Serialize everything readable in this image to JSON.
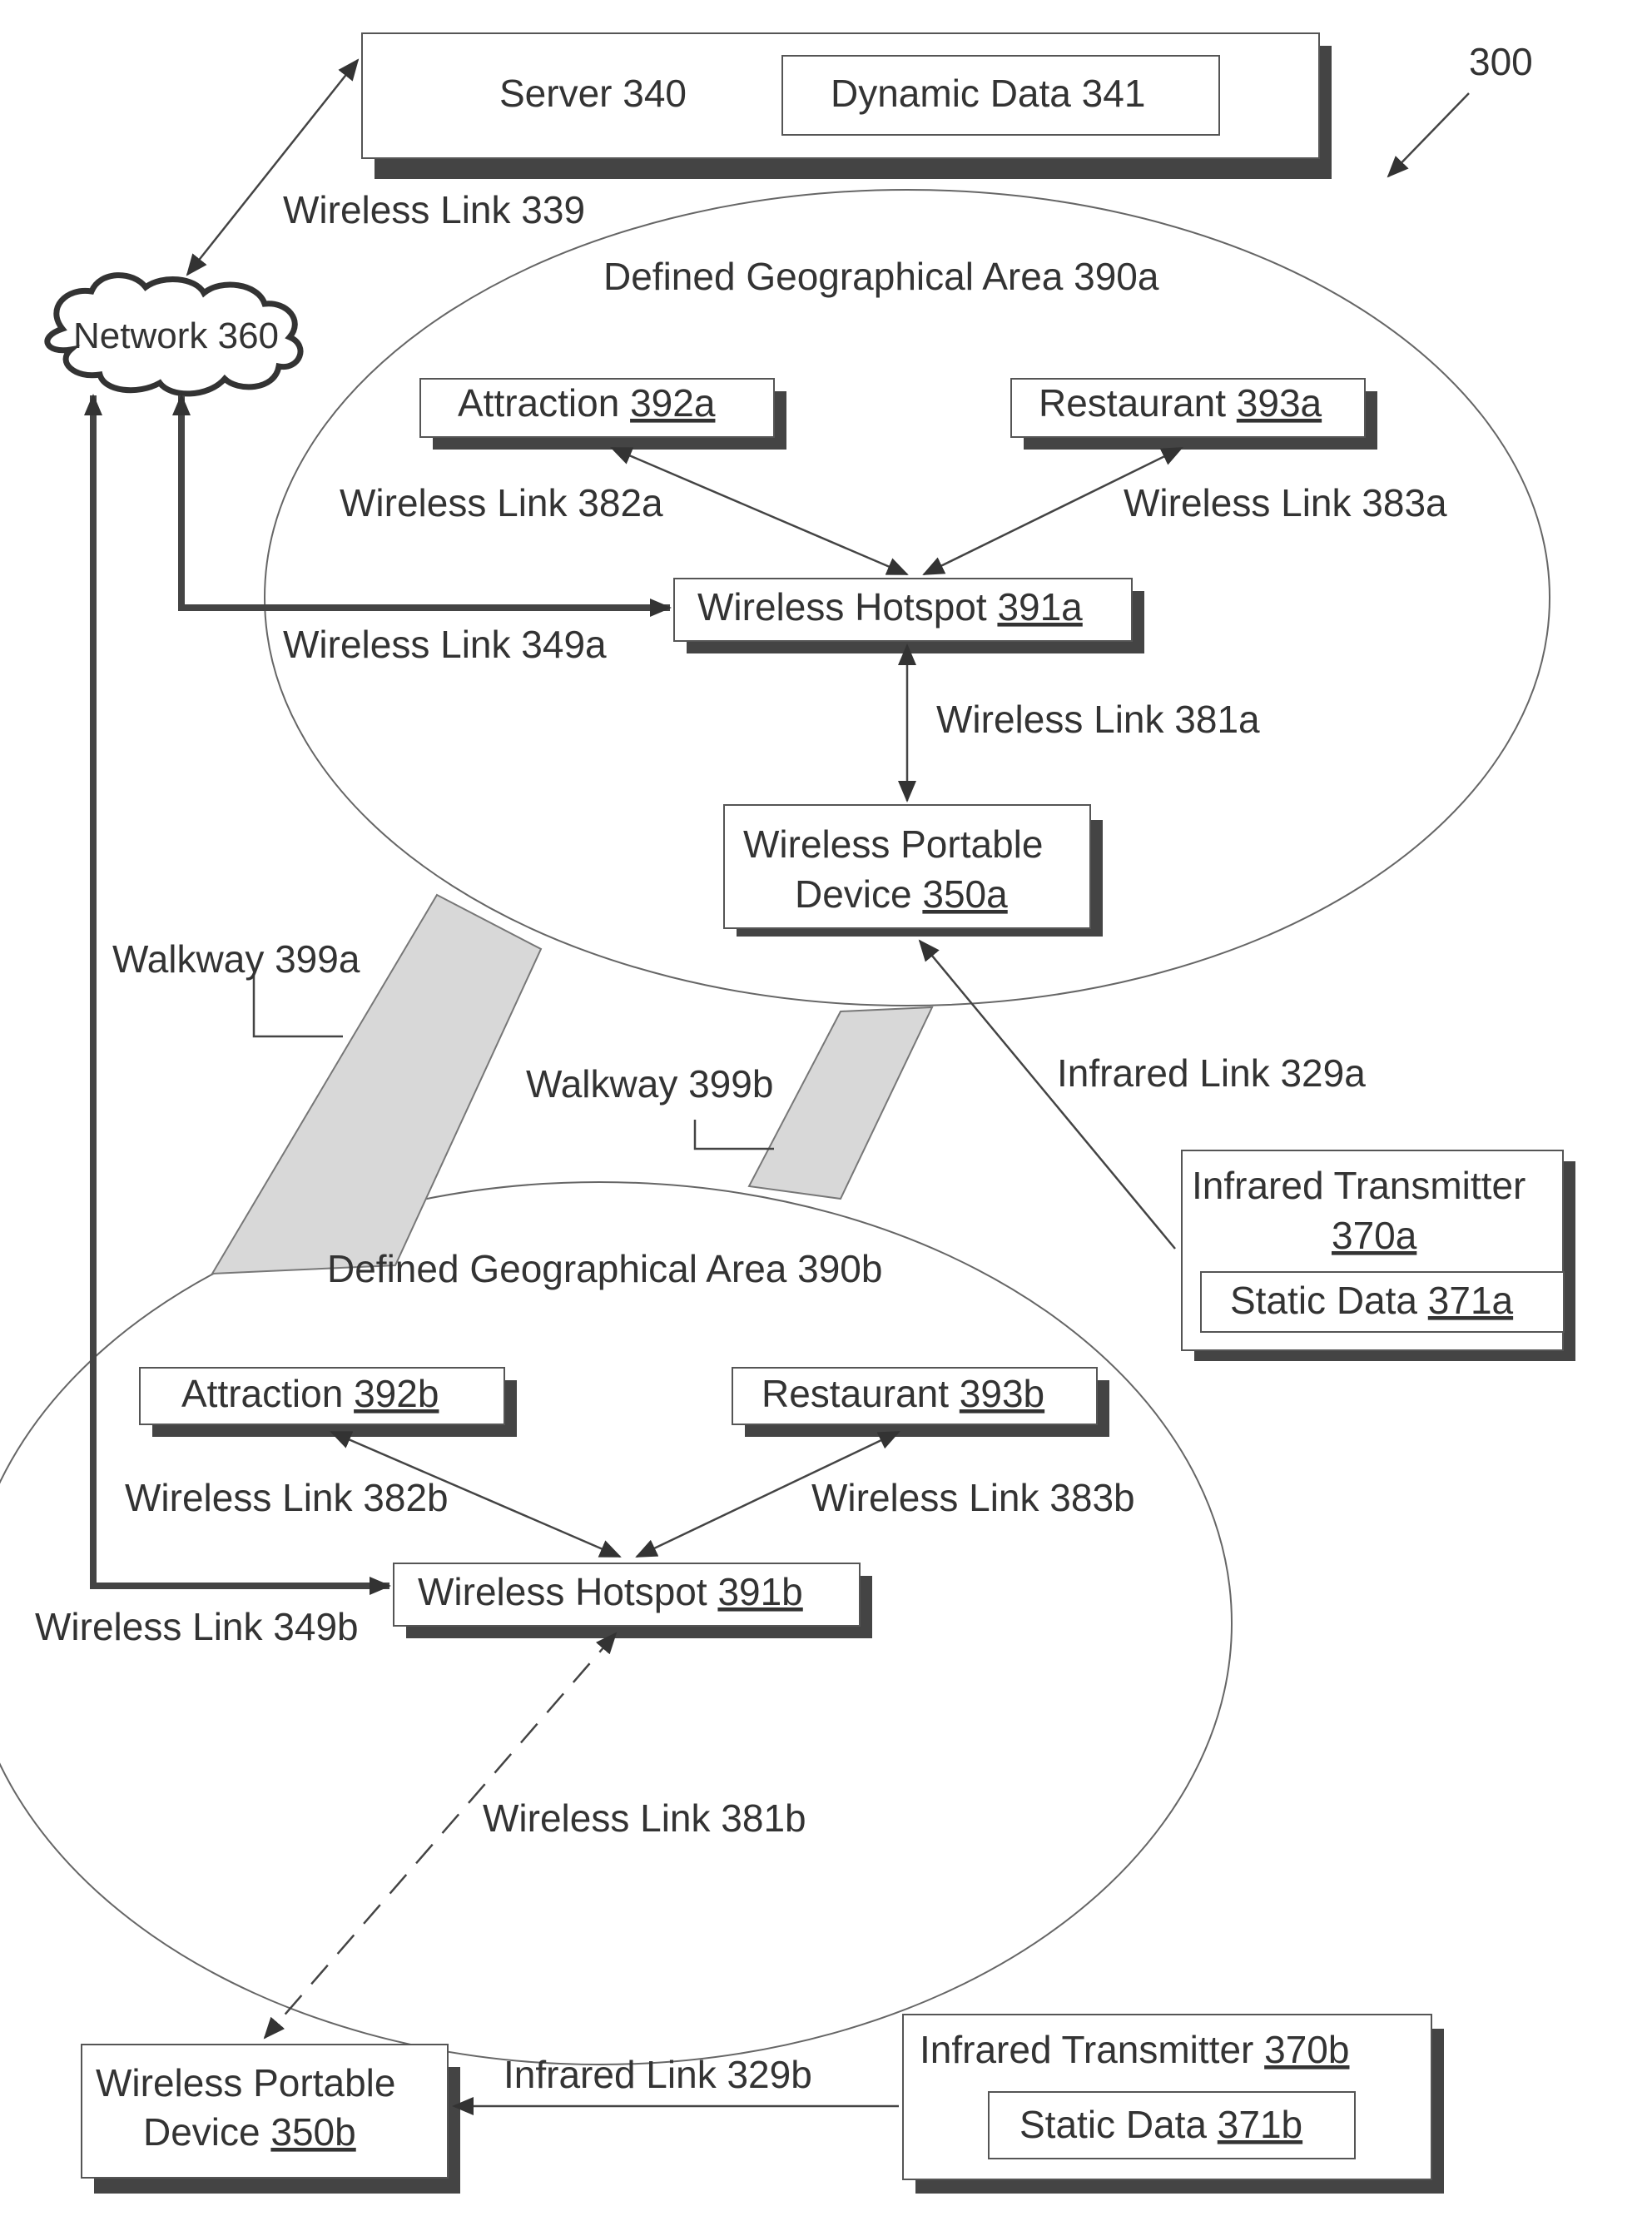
{
  "figure_ref": "300",
  "server": {
    "label": "Server 340",
    "data_label": "Dynamic Data 341"
  },
  "network": {
    "label": "Network 360"
  },
  "links": {
    "l339": "Wireless Link 339",
    "l382a": "Wireless Link 382a",
    "l383a": "Wireless Link 383a",
    "l349a": "Wireless Link 349a",
    "l381a": "Wireless Link 381a",
    "l329a": "Infrared Link 329a",
    "l382b": "Wireless Link 382b",
    "l383b": "Wireless Link 383b",
    "l349b": "Wireless Link 349b",
    "l381b": "Wireless Link 381b",
    "l329b": "Infrared Link 329b"
  },
  "area_a": {
    "title": "Defined Geographical Area 390a",
    "attraction": {
      "text": "Attraction ",
      "num": "392a"
    },
    "restaurant": {
      "text": "Restaurant ",
      "num": "393a"
    },
    "hotspot": {
      "text": "Wireless Hotspot ",
      "num": "391a"
    },
    "device": {
      "line1": "Wireless Portable",
      "text": "Device ",
      "num": "350a"
    }
  },
  "area_b": {
    "title": "Defined Geographical Area 390b",
    "attraction": {
      "text": "Attraction ",
      "num": "392b"
    },
    "restaurant": {
      "text": "Restaurant ",
      "num": "393b"
    },
    "hotspot": {
      "text": "Wireless Hotspot ",
      "num": "391b"
    },
    "device": {
      "line1": "Wireless Portable",
      "text": "Device ",
      "num": "350b"
    }
  },
  "walkways": {
    "a": "Walkway 399a",
    "b": "Walkway 399b"
  },
  "ir_a": {
    "line1": "Infrared Transmitter",
    "num": "370a",
    "static_text": "Static Data ",
    "static_num": "371a"
  },
  "ir_b": {
    "text": "Infrared Transmitter ",
    "num": "370b",
    "static_text": "Static Data ",
    "static_num": "371b"
  }
}
